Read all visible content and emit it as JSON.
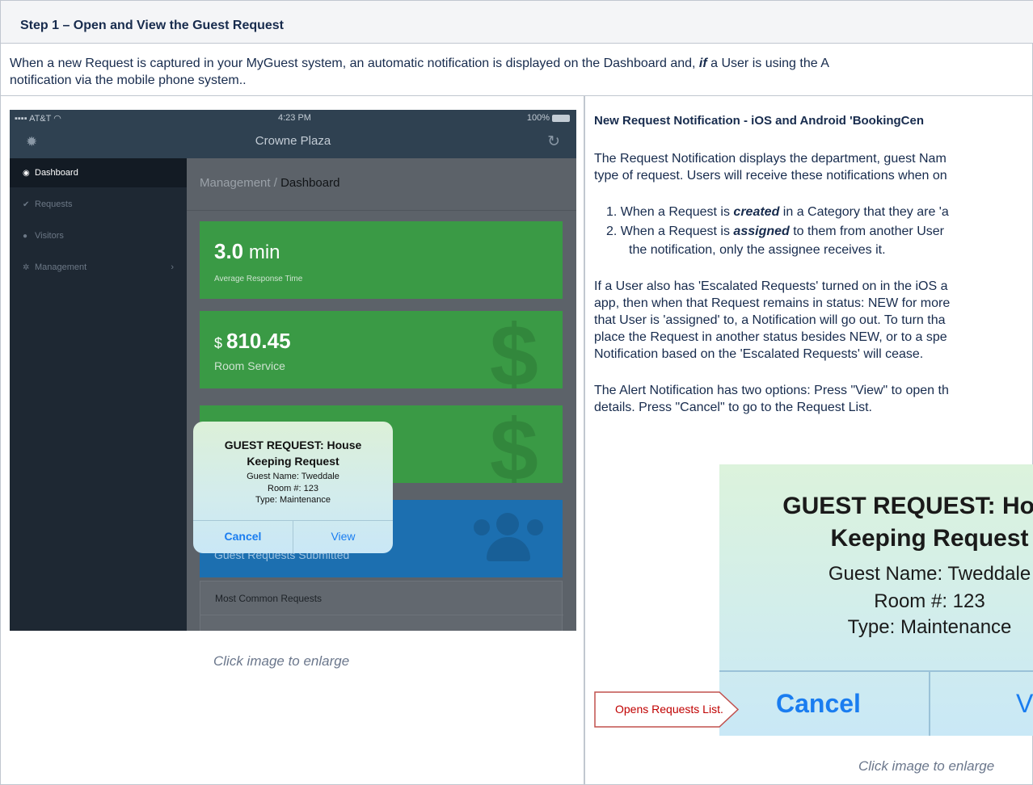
{
  "step": {
    "title": "Step 1 – Open and View  the Guest Request"
  },
  "intro": {
    "part1": "When a new Request is captured in your MyGuest system, an automatic notification is displayed on the Dashboard and, ",
    "emph": "if",
    "part2": " a User is using the A",
    "line2": "notification via the mobile phone system.."
  },
  "ipad": {
    "status": {
      "carrier": "AT&T",
      "time": "4:23 PM",
      "battery": "100%"
    },
    "app_title": "Crowne Plaza",
    "sidebar": [
      {
        "label": "Dashboard",
        "icon": "dashboard-icon"
      },
      {
        "label": "Requests",
        "icon": "check-icon"
      },
      {
        "label": "Visitors",
        "icon": "users-icon"
      },
      {
        "label": "Management",
        "icon": "cog-icon"
      }
    ],
    "breadcrumb": {
      "parent": "Management / ",
      "current": "Dashboard"
    },
    "cards": {
      "response": {
        "value": "3.0",
        "unit": " min",
        "label": "Average Response Time"
      },
      "room_service": {
        "currency": "$ ",
        "value": "810.45",
        "label": "Room Service"
      },
      "requests": {
        "label": "Guest Requests Submitted"
      }
    },
    "most_common": "Most Common Requests",
    "alert": {
      "title": "GUEST REQUEST: House Keeping Request",
      "guest": "Guest Name: Tweddale",
      "room": "Room #: 123",
      "type": "Type: Maintenance",
      "cancel": "Cancel",
      "view": "View"
    }
  },
  "caption_left": "Click image to enlarge",
  "right": {
    "heading": "New Request Notification - iOS and Android 'BookingCen",
    "p1_l1": "The Request Notification displays the department, guest Nam",
    "p1_l2": "type of request. Users will receive these notifications when on",
    "li1_a": "1.  When a Request is ",
    "li1_em": "created",
    "li1_b": " in a Category that they are 'a",
    "li2_a": "2.  When a Request is ",
    "li2_em": "assigned",
    "li2_b": " to them from another User",
    "li2_l2": "the notification, only the assignee receives it.",
    "p2_l1": "If a User also has 'Escalated Requests' turned on in the iOS a",
    "p2_l2": "app, then when that Request remains in status: NEW for more",
    "p2_l3": "that User is 'assigned' to, a Notification will go out.  To turn tha",
    "p2_l4": "place the Request in another status besides NEW, or to a spe",
    "p2_l5": "Notification based on the 'Escalated Requests' will cease.",
    "p3_l1": "The Alert Notification has two options: Press \"View\" to open th",
    "p3_l2": "details. Press \"Cancel\" to go to the Request List.",
    "zoom": {
      "title_l1": "GUEST REQUEST: House",
      "title_l2": "Keeping Request",
      "guest": "Guest Name: Tweddale",
      "room": "Room #: 123",
      "type": "Type: Maintenance",
      "cancel": "Cancel",
      "view": "View"
    },
    "callout": "Opens Requests List.",
    "caption": "Click image to enlarge"
  }
}
